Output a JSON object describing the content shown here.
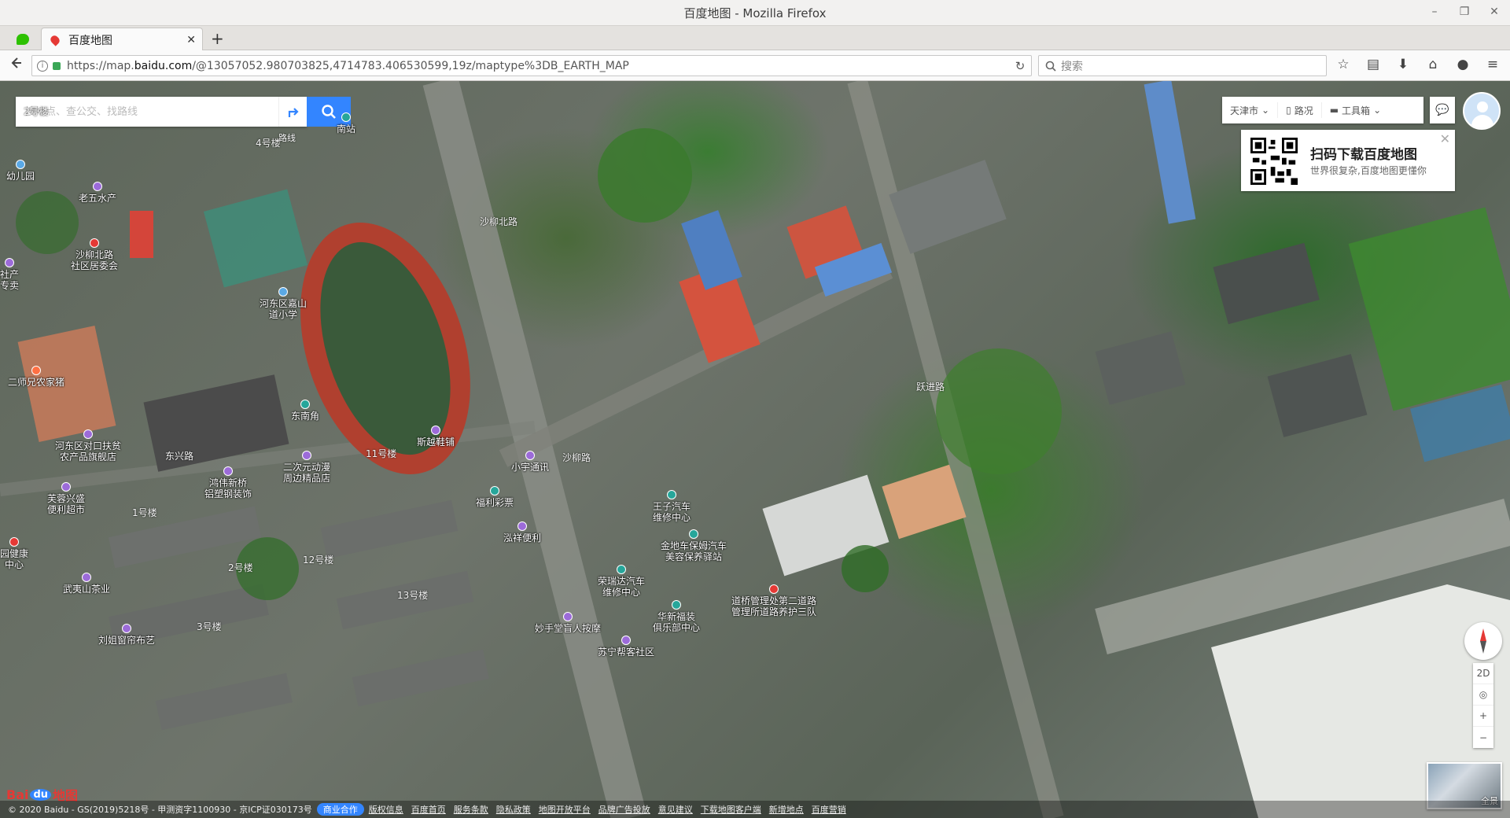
{
  "window": {
    "title": "百度地图 - Mozilla Firefox"
  },
  "tabs": [
    {
      "label": "百度地图"
    }
  ],
  "navbar": {
    "url_prefix": "https://map.",
    "url_host": "baidu.com",
    "url_rest": "/@13057052.980703825,4714783.406530599,19z/maptype%3DB_EARTH_MAP",
    "search_placeholder": "搜索"
  },
  "map": {
    "search_placeholder": "搜地点、查公交、找路线",
    "route_tip": "路线",
    "city": "天津市",
    "traffic": "路况",
    "toolbox": "工具箱",
    "qr": {
      "title": "扫码下载百度地图",
      "subtitle": "世界很复杂,百度地图更懂你"
    },
    "view_mode": "2D",
    "thumbnail_label": "全景",
    "pois": [
      {
        "name": "幼儿园",
        "color": "#5aa9e6"
      },
      {
        "name": "老五水产",
        "color": "#9c6bd9"
      },
      {
        "name": "沙柳北路\n社区居委会",
        "color": "#e53935"
      },
      {
        "name": "河东区嘉山\n道小学",
        "color": "#5aa9e6"
      },
      {
        "name": "二师兄农家猪",
        "color": "#ff7043"
      },
      {
        "name": "东南角",
        "color": "#26a69a"
      },
      {
        "name": "南站",
        "color": "#26a69a"
      },
      {
        "name": "河东区对口扶贫\n农产品旗舰店",
        "color": "#9c6bd9"
      },
      {
        "name": "芙蓉兴盛\n便利超市",
        "color": "#9c6bd9"
      },
      {
        "name": "鸿伟新桥\n铝塑钢装饰",
        "color": "#9c6bd9"
      },
      {
        "name": "二次元动漫\n周边精品店",
        "color": "#9c6bd9"
      },
      {
        "name": "斯越鞋铺",
        "color": "#9c6bd9"
      },
      {
        "name": "小宇通讯",
        "color": "#9c6bd9"
      },
      {
        "name": "福利彩票",
        "color": "#26a69a"
      },
      {
        "name": "泓祥便利",
        "color": "#9c6bd9"
      },
      {
        "name": "王子汽车\n维修中心",
        "color": "#26a69a"
      },
      {
        "name": "金地车保姆汽车\n美容保养驿站",
        "color": "#26a69a"
      },
      {
        "name": "荣瑞达汽车\n维修中心",
        "color": "#26a69a"
      },
      {
        "name": "华新福装\n俱乐部中心",
        "color": "#26a69a"
      },
      {
        "name": "道桥管理处第二道路\n管理所道路养护三队",
        "color": "#e53935"
      },
      {
        "name": "妙手堂盲人按摩",
        "color": "#9c6bd9"
      },
      {
        "name": "武夷山茶业",
        "color": "#9c6bd9"
      },
      {
        "name": "园健康\n中心",
        "color": "#e53935"
      },
      {
        "name": "苏宁帮客社区",
        "color": "#9c6bd9"
      },
      {
        "name": "刘姐窗帘布艺",
        "color": "#9c6bd9"
      },
      {
        "name": "社产\n专卖",
        "color": "#9c6bd9"
      }
    ],
    "roads": [
      "2号楼",
      "4号楼",
      "沙柳北路",
      "11号楼",
      "1号楼",
      "2号楼",
      "12号楼",
      "13号楼",
      "3号楼",
      "东兴路",
      "沙柳路",
      "跃进路"
    ],
    "footer": {
      "copyright": "© 2020 Baidu - GS(2019)5218号 - 甲测资字1100930 - 京ICP证030173号",
      "business": "商业合作",
      "links": [
        "版权信息",
        "百度首页",
        "服务条款",
        "隐私政策",
        "地图开放平台",
        "品牌广告投放",
        "意见建议",
        "下载地图客户端",
        "新增地点",
        "百度营销"
      ]
    },
    "logo": {
      "a": "Bai",
      "du": "du",
      "b": "地图"
    }
  }
}
